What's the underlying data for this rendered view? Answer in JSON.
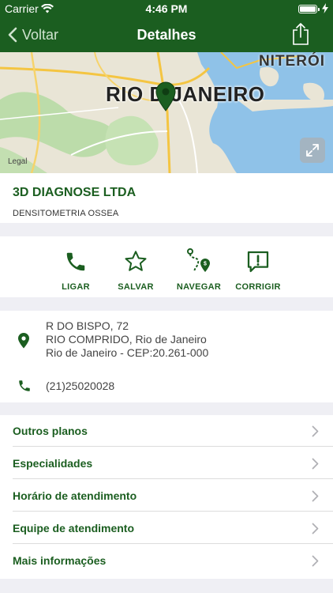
{
  "status_bar": {
    "carrier": "Carrier",
    "time": "4:46 PM",
    "battery_level": 1.0
  },
  "nav": {
    "back_label": "Voltar",
    "title": "Detalhes"
  },
  "map": {
    "city_label": "Rio De Janeiro",
    "city_label_display": "RIO D JANEIRO",
    "neighbor_label": "NITERÓI",
    "legal_label": "Legal"
  },
  "provider": {
    "name": "3D DIAGNOSE LTDA",
    "specialty": "DENSITOMETRIA OSSEA"
  },
  "actions": [
    {
      "label": "LIGAR",
      "icon": "phone-icon"
    },
    {
      "label": "SALVAR",
      "icon": "star-icon"
    },
    {
      "label": "NAVEGAR",
      "icon": "route-icon"
    },
    {
      "label": "CORRIGIR",
      "icon": "alert-icon"
    }
  ],
  "contact": {
    "address_line1": "R DO BISPO, 72",
    "address_line2": "RIO COMPRIDO, Rio de Janeiro",
    "address_line3": "Rio de Janeiro - CEP:20.261-000",
    "phone": "(21)25020028"
  },
  "menu": [
    {
      "label": "Outros planos"
    },
    {
      "label": "Especialidades"
    },
    {
      "label": "Horário de atendimento"
    },
    {
      "label": "Equipe de atendimento"
    },
    {
      "label": "Mais informações"
    }
  ],
  "colors": {
    "brand": "#1b5e20",
    "background": "#efeff4"
  }
}
